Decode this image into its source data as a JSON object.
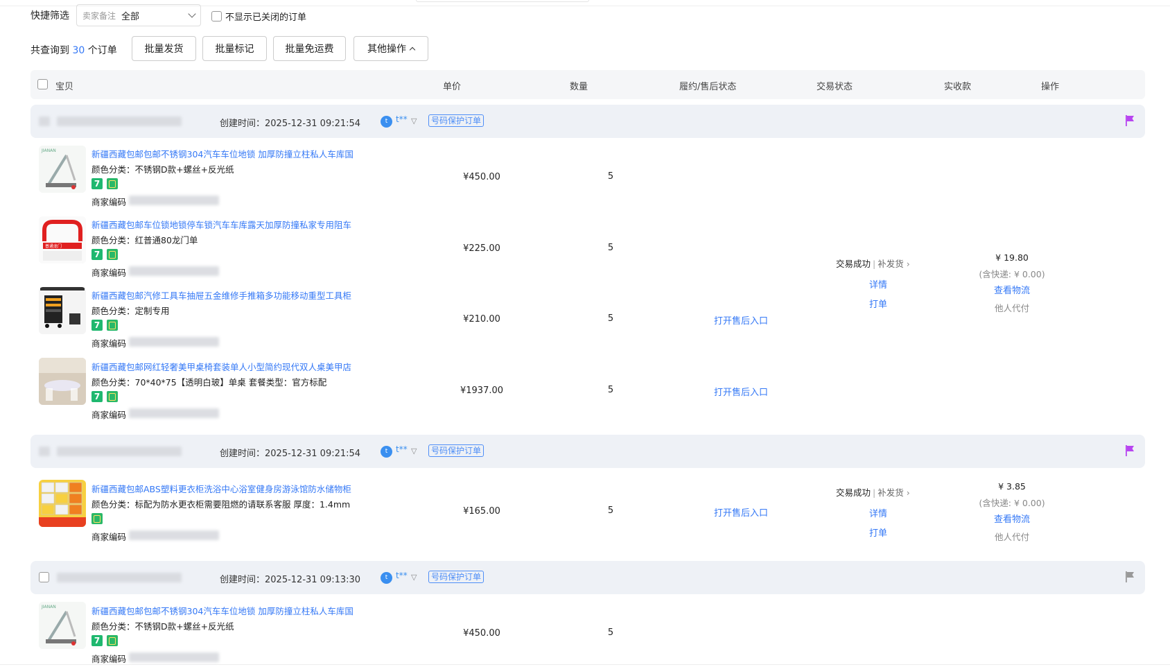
{
  "filter": {
    "label": "快捷筛选",
    "select_prefix": "卖家备注",
    "select_value": "全部",
    "hide_closed_label": "不显示已关闭的订单"
  },
  "summary": {
    "prefix": "共查询到",
    "count": "30",
    "suffix": "个订单"
  },
  "toolbar": {
    "batch_ship": "批量发货",
    "batch_mark": "批量标记",
    "batch_free_shipping": "批量免运费",
    "other_ops": "其他操作"
  },
  "table_headers": {
    "item": "宝贝",
    "price": "单价",
    "quantity": "数量",
    "fulfillment": "履约/售后状态",
    "trade_status": "交易状态",
    "received": "实收款",
    "operation": "操作"
  },
  "orders": [
    {
      "created": "创建时间：2025-12-31 09:21:54",
      "buyer": "t**",
      "badge": "号码保护订单",
      "flag_color": "#b845f0",
      "items": [
        {
          "title": "新疆西藏包邮包邮不锈钢304汽车车位地锁 加厚防撞立柱私人车库国",
          "variant": "颜色分类：不锈钢D款+螺丝+反光纸",
          "code_label": "商家编码",
          "price": "¥450.00",
          "qty": "5",
          "after": "",
          "tags": [
            "7",
            "b"
          ]
        },
        {
          "title": "新疆西藏包邮车位锁地锁停车锁汽车车库露天加厚防撞私家专用阻车",
          "variant": "颜色分类：红普通80龙门单",
          "code_label": "商家编码",
          "price": "¥225.00",
          "qty": "5",
          "after": "",
          "tags": [
            "7",
            "b"
          ]
        },
        {
          "title": "新疆西藏包邮汽修工具车抽屉五金维修手推箱多功能移动重型工具柜",
          "variant": "颜色分类：定制专用",
          "code_label": "商家编码",
          "price": "¥210.00",
          "qty": "5",
          "after": "打开售后入口",
          "tags": [
            "7",
            "b"
          ]
        },
        {
          "title": "新疆西藏包邮网红轻奢美甲桌椅套装单人小型简约现代双人桌美甲店",
          "variant": "颜色分类：70*40*75【透明白玻】单桌  套餐类型：官方标配",
          "code_label": "商家编码",
          "price": "¥1937.00",
          "qty": "5",
          "after": "打开售后入口",
          "tags": [
            "7",
            "b"
          ]
        }
      ],
      "status": "交易成功",
      "status_sub": "补发货",
      "detail": "详情",
      "print": "打单",
      "paid": "¥ 19.80",
      "shipping": "(含快递: ¥ 0.00)",
      "logistics": "查看物流",
      "payer": "他人代付"
    },
    {
      "created": "创建时间：2025-12-31 09:21:54",
      "buyer": "t**",
      "badge": "号码保护订单",
      "flag_color": "#b845f0",
      "items": [
        {
          "title": "新疆西藏包邮ABS塑料更衣柜洗浴中心浴室健身房游泳馆防水储物柜",
          "variant": "颜色分类：标配为防水更衣柜需要阻燃的请联系客服  厚度：1.4mm",
          "code_label": "商家编码",
          "price": "¥165.00",
          "qty": "5",
          "after": "打开售后入口",
          "tags": [
            "b"
          ]
        }
      ],
      "status": "交易成功",
      "status_sub": "补发货",
      "detail": "详情",
      "print": "打单",
      "paid": "¥ 3.85",
      "shipping": "(含快递: ¥ 0.00)",
      "logistics": "查看物流",
      "payer": "他人代付"
    },
    {
      "created": "创建时间：2025-12-31 09:13:30",
      "buyer": "t**",
      "badge": "号码保护订单",
      "flag_color": "#999999",
      "items": [
        {
          "title": "新疆西藏包邮包邮不锈钢304汽车车位地锁 加厚防撞立柱私人车库国",
          "variant": "颜色分类：不锈钢D款+螺丝+反光纸",
          "code_label": "商家编码",
          "price": "¥450.00",
          "qty": "5",
          "after": "",
          "tags": [
            "7",
            "b"
          ]
        }
      ]
    }
  ]
}
